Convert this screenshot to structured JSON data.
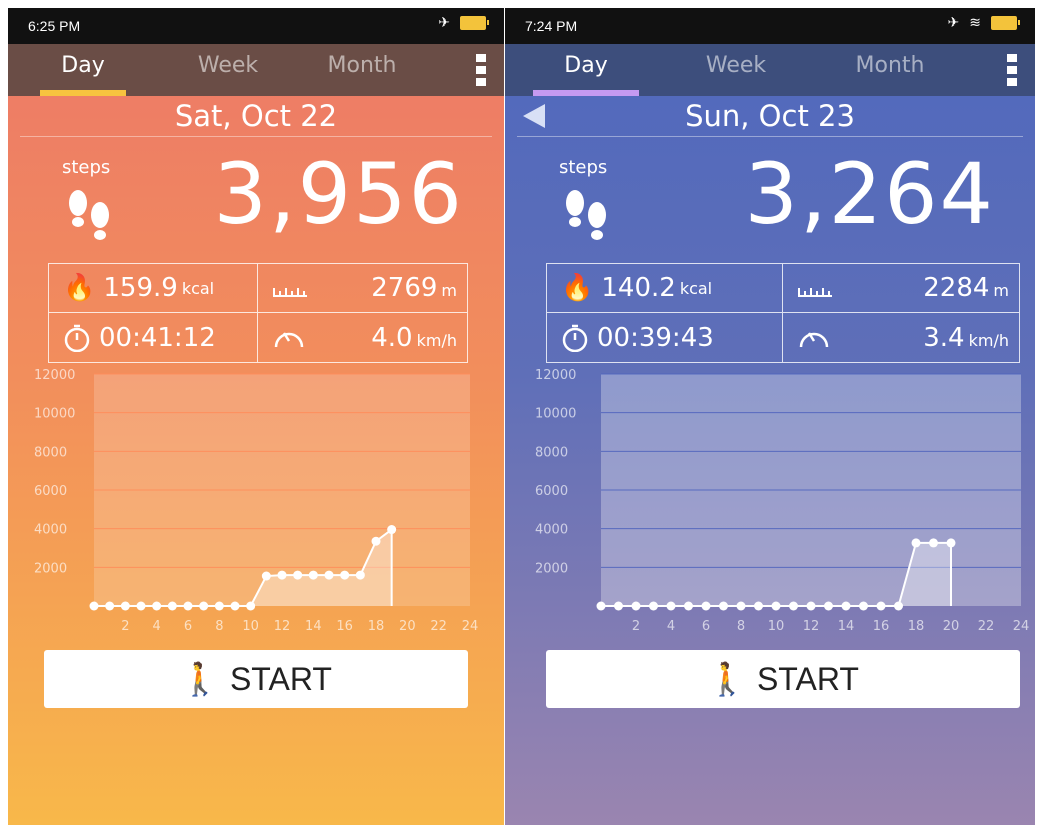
{
  "screens": [
    {
      "status": {
        "time": "6:25 PM"
      },
      "tabs": {
        "day": "Day",
        "week": "Week",
        "month": "Month"
      },
      "date": "Sat, Oct 22",
      "steps_label": "steps",
      "steps": "3,956",
      "stats": {
        "kcal": "159.9",
        "kcal_unit": "kcal",
        "distance": "2769",
        "distance_unit": "m",
        "time": "00:41:12",
        "speed": "4.0",
        "speed_unit": "km/h"
      },
      "start_label": "START",
      "colors": {
        "tab_bar": "#6a4d46",
        "indicator": "#f7c33f",
        "bg_top": "#ec7868",
        "bg_bottom": "#f8b84a"
      },
      "chart_data": {
        "type": "area",
        "y_ticks": [
          "12000",
          "10000",
          "8000",
          "6000",
          "4000",
          "2000"
        ],
        "x_ticks": [
          "2",
          "4",
          "6",
          "8",
          "10",
          "12",
          "14",
          "16",
          "18",
          "20",
          "22",
          "24"
        ],
        "ylim": [
          0,
          12000
        ],
        "xlim": [
          0,
          24
        ],
        "x": [
          0,
          1,
          2,
          3,
          4,
          5,
          6,
          7,
          8,
          9,
          10,
          11,
          12,
          13,
          14,
          15,
          16,
          17,
          18,
          19
        ],
        "values": [
          0,
          0,
          0,
          0,
          0,
          0,
          0,
          0,
          0,
          0,
          0,
          1550,
          1600,
          1600,
          1600,
          1600,
          1600,
          1600,
          3350,
          3956
        ]
      }
    },
    {
      "status": {
        "time": "7:24 PM"
      },
      "tabs": {
        "day": "Day",
        "week": "Week",
        "month": "Month"
      },
      "date": "Sun, Oct 23",
      "steps_label": "steps",
      "steps": "3,264",
      "stats": {
        "kcal": "140.2",
        "kcal_unit": "kcal",
        "distance": "2284",
        "distance_unit": "m",
        "time": "00:39:43",
        "speed": "3.4",
        "speed_unit": "km/h"
      },
      "start_label": "START",
      "colors": {
        "tab_bar": "#3d4e7c",
        "indicator": "#c59af1",
        "bg_top": "#4f68bd",
        "bg_bottom": "#9a85b0"
      },
      "chart_data": {
        "type": "area",
        "y_ticks": [
          "12000",
          "10000",
          "8000",
          "6000",
          "4000",
          "2000"
        ],
        "x_ticks": [
          "2",
          "4",
          "6",
          "8",
          "10",
          "12",
          "14",
          "16",
          "18",
          "20",
          "22",
          "24"
        ],
        "ylim": [
          0,
          12000
        ],
        "xlim": [
          0,
          24
        ],
        "x": [
          0,
          1,
          2,
          3,
          4,
          5,
          6,
          7,
          8,
          9,
          10,
          11,
          12,
          13,
          14,
          15,
          16,
          17,
          18,
          19,
          20
        ],
        "values": [
          0,
          0,
          0,
          0,
          0,
          0,
          0,
          0,
          0,
          0,
          0,
          0,
          0,
          0,
          0,
          0,
          0,
          0,
          3264,
          3264,
          3264
        ]
      }
    }
  ]
}
